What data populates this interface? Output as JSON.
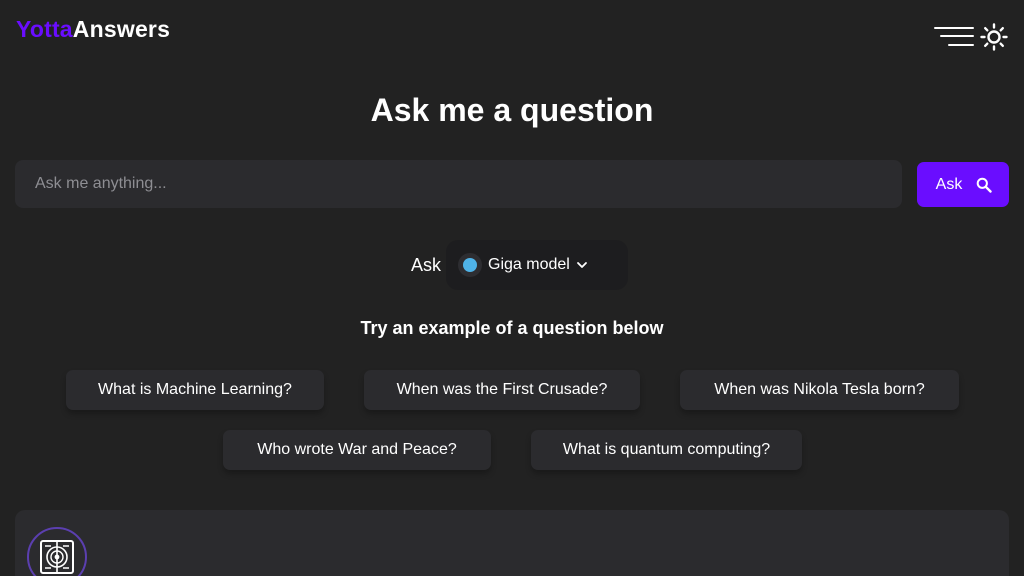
{
  "header": {
    "brand_part1": "Yotta",
    "brand_part2": "Answers",
    "brand_color": "#6a0dff",
    "menu_icon": "hamburger-menu-icon",
    "theme_icon": "sun-icon"
  },
  "main": {
    "headline": "Ask me a question",
    "search": {
      "placeholder": "Ask me anything...",
      "value": "",
      "button_label": "Ask",
      "button_icon": "search-icon"
    },
    "model": {
      "prefix_label": "Ask",
      "selected": "Giga model",
      "dot_color": "#4fb3e8"
    },
    "examples": {
      "title": "Try an example of a question below",
      "items": [
        "What is Machine Learning?",
        "When was the First Crusade?",
        "When was Nikola Tesla born?",
        "Who wrote War and Peace?",
        "What is quantum computing?"
      ]
    },
    "answer_card": {
      "avatar_icon": "labyrinth-book-icon"
    }
  }
}
